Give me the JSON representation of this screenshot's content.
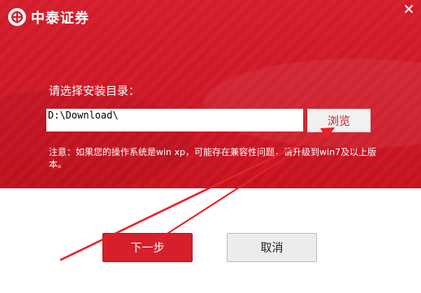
{
  "app": {
    "brand_name": "中泰证券",
    "colors": {
      "brand_red": "#d61e2b",
      "text_light": "#ffffff",
      "annotation_red": "#e8202a"
    }
  },
  "install": {
    "label": "请选择安装目录：",
    "path_value": "D:\\Download\\",
    "browse_label": "浏览"
  },
  "note": {
    "text": "注意：如果您的操作系统是win xp，可能存在兼容性问题，请升级到win7及以上版本。"
  },
  "buttons": {
    "next_label": "下一步",
    "cancel_label": "取消"
  },
  "icons": {
    "logo": "brand-logo-icon",
    "close": "close-icon"
  }
}
